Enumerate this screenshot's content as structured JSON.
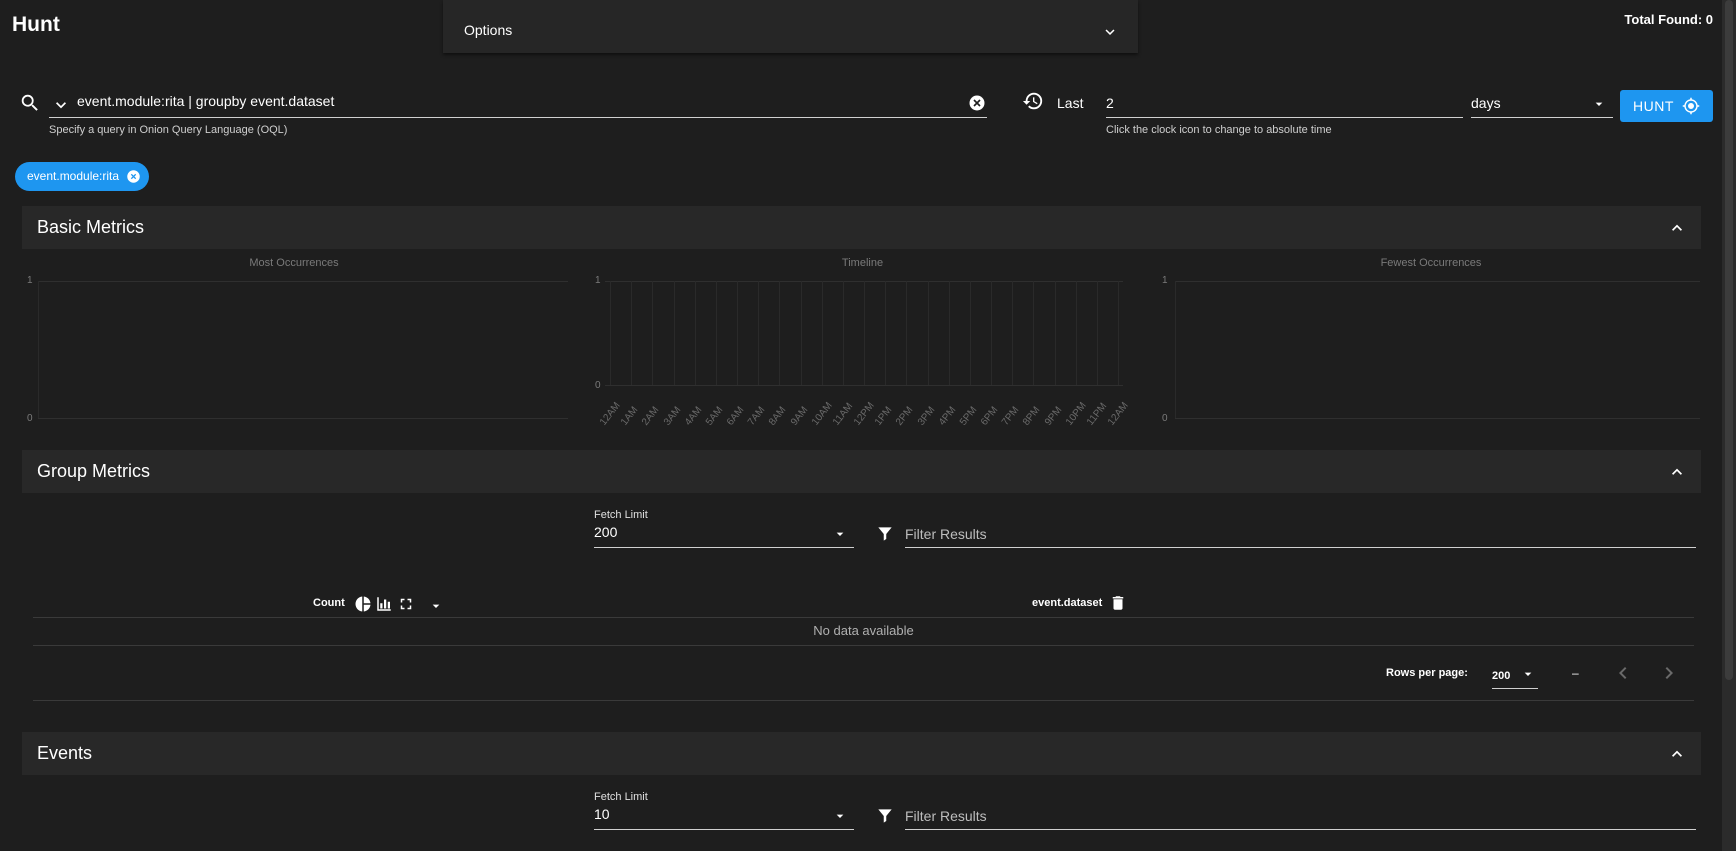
{
  "page": {
    "title": "Hunt",
    "total_found": "Total Found: 0",
    "options_label": "Options"
  },
  "search": {
    "query": "event.module:rita | groupby event.dataset",
    "hint": "Specify a query in Onion Query Language (OQL)"
  },
  "time": {
    "last_label": "Last",
    "value": "2",
    "unit": "days",
    "hint": "Click the clock icon to change to absolute time"
  },
  "hunt_button": "HUNT",
  "chips": [
    {
      "label": "event.module:rita"
    }
  ],
  "basic_metrics": {
    "title": "Basic Metrics",
    "most": {
      "title": "Most Occurrences",
      "y_top": "1",
      "y_bottom": "0"
    },
    "timeline": {
      "title": "Timeline",
      "y_top": "1",
      "y_bottom": "0",
      "ticks": [
        "12AM",
        "1AM",
        "2AM",
        "3AM",
        "4AM",
        "5AM",
        "6AM",
        "7AM",
        "8AM",
        "9AM",
        "10AM",
        "11AM",
        "12PM",
        "1PM",
        "2PM",
        "3PM",
        "4PM",
        "5PM",
        "6PM",
        "7PM",
        "8PM",
        "9PM",
        "10PM",
        "11PM",
        "12AM"
      ]
    },
    "fewest": {
      "title": "Fewest Occurrences",
      "y_top": "1",
      "y_bottom": "0"
    }
  },
  "group_metrics": {
    "title": "Group Metrics",
    "fetch_limit_label": "Fetch Limit",
    "fetch_limit": "200",
    "filter_placeholder": "Filter Results",
    "columns": {
      "count": "Count",
      "field": "event.dataset"
    },
    "empty": "No data available",
    "rows_per_page_label": "Rows per page:",
    "rows_per_page": "200",
    "range": "–"
  },
  "events": {
    "title": "Events",
    "fetch_limit_label": "Fetch Limit",
    "fetch_limit": "10",
    "filter_placeholder": "Filter Results"
  }
}
